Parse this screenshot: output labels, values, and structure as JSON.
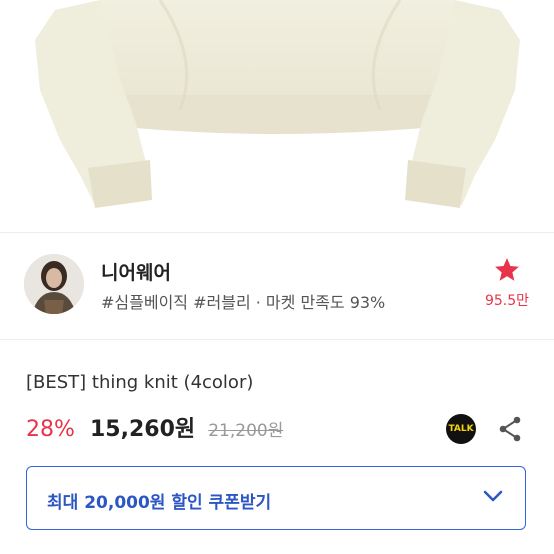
{
  "shop": {
    "name": "니어웨어",
    "tags": "#심플베이직 #러블리 · 마켓 만족도 93%",
    "likes": "95.5만",
    "like_icon": "star-icon"
  },
  "product": {
    "title": "[BEST] thing knit (4color)",
    "discount": "28%",
    "price": "15,260원",
    "original_price": "21,200원"
  },
  "actions": {
    "talk_label": "TALK"
  },
  "coupon": {
    "label": "최대 20,000원 할인 쿠폰받기"
  },
  "colors": {
    "accent_red": "#e8344a",
    "coupon_blue": "#3667d8",
    "talk_yellow": "#f6d40a"
  }
}
